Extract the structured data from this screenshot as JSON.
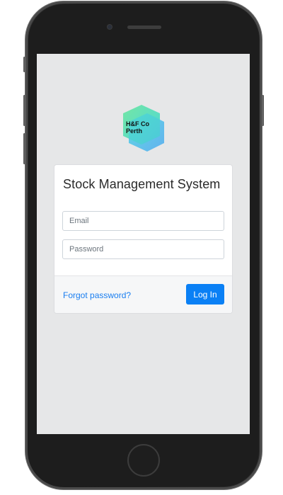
{
  "logo": {
    "line1": "H&F Co",
    "line2": "Perth",
    "colors": [
      "#5fe3a1",
      "#4fd4e0",
      "#4db3f0"
    ]
  },
  "login": {
    "title": "Stock Management System",
    "email_placeholder": "Email",
    "password_placeholder": "Password",
    "forgot_label": "Forgot password?",
    "submit_label": "Log In"
  },
  "colors": {
    "accent": "#0a80f5",
    "link": "#1a7ef0",
    "screen_bg": "#e6e7e8",
    "card_bg": "#ffffff",
    "footer_bg": "#f6f7f8"
  }
}
